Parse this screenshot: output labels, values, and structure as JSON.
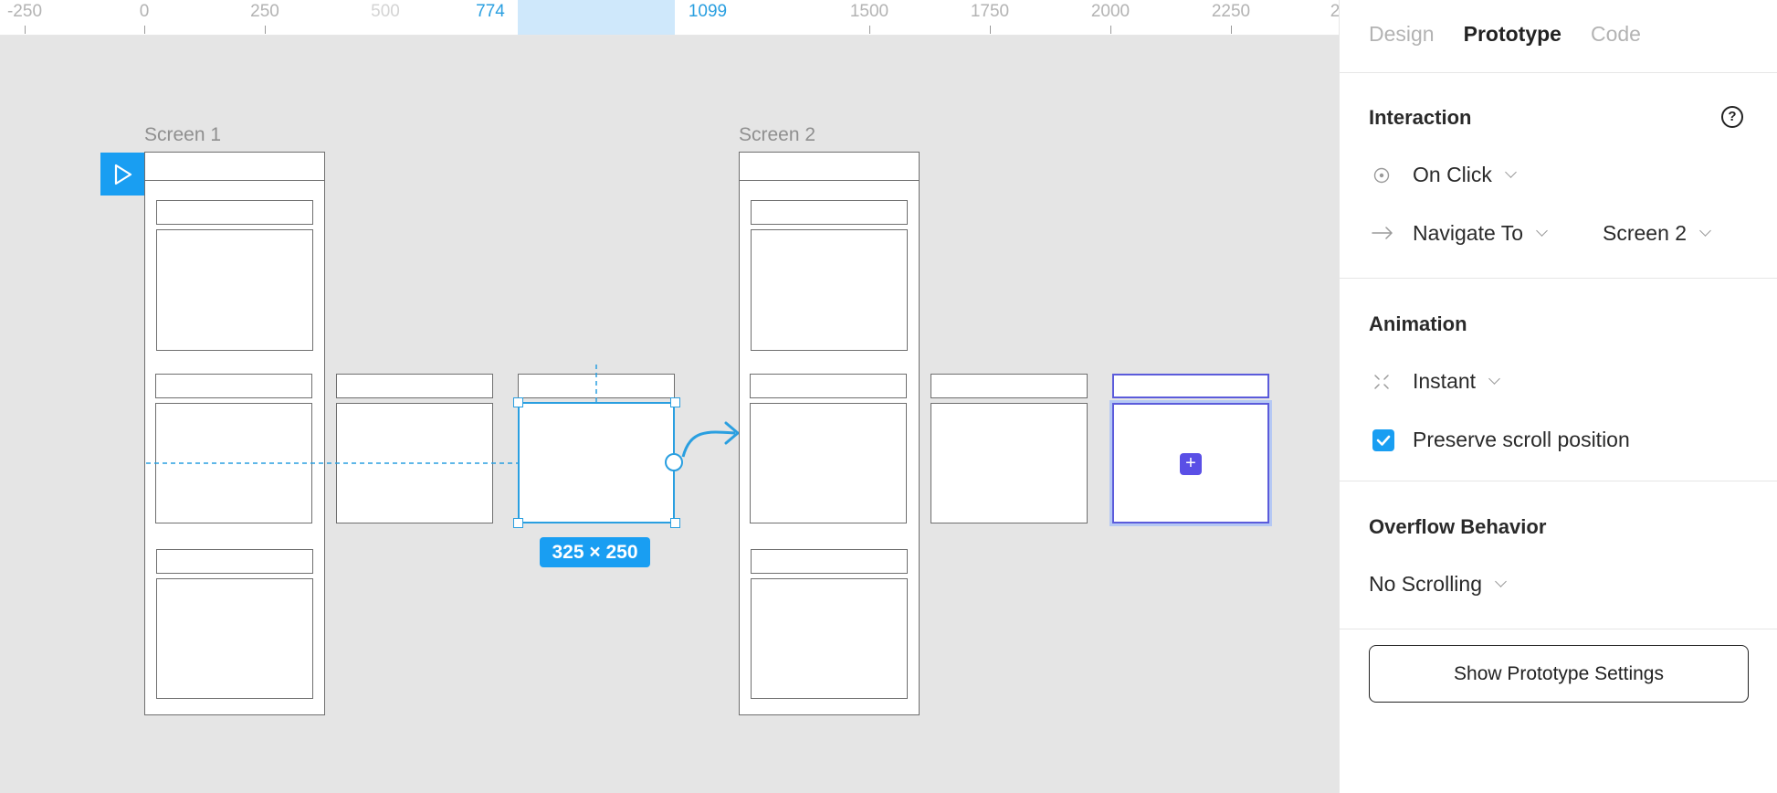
{
  "ruler": {
    "ticks": [
      {
        "label": "-250",
        "style": "normal"
      },
      {
        "label": "0",
        "style": "normal"
      },
      {
        "label": "250",
        "style": "normal"
      },
      {
        "label": "500",
        "style": "faint"
      },
      {
        "label": "774",
        "style": "accent"
      },
      {
        "label": "1099",
        "style": "accent"
      },
      {
        "label": "1500",
        "style": "normal"
      },
      {
        "label": "1750",
        "style": "normal"
      },
      {
        "label": "2000",
        "style": "normal"
      },
      {
        "label": "2250",
        "style": "normal"
      },
      {
        "label": "2",
        "style": "normal"
      }
    ]
  },
  "canvas": {
    "frame1_title": "Screen 1",
    "frame2_title": "Screen 2",
    "selection_size": "325 × 250",
    "add_symbol": "+"
  },
  "panel": {
    "tabs": [
      {
        "label": "Design",
        "active": false
      },
      {
        "label": "Prototype",
        "active": true
      },
      {
        "label": "Code",
        "active": false
      }
    ],
    "interaction": {
      "title": "Interaction",
      "help_symbol": "?",
      "trigger": "On Click",
      "action": "Navigate To",
      "destination": "Screen 2"
    },
    "animation": {
      "title": "Animation",
      "type": "Instant",
      "preserve_scroll_label": "Preserve scroll position",
      "preserve_scroll_checked": true
    },
    "overflow": {
      "title": "Overflow Behavior",
      "value": "No Scrolling"
    },
    "settings_button": "Show Prototype Settings"
  },
  "colors": {
    "accent": "#199ef2",
    "purple": "#5a4fe6",
    "canvas_bg": "#e5e5e5"
  }
}
